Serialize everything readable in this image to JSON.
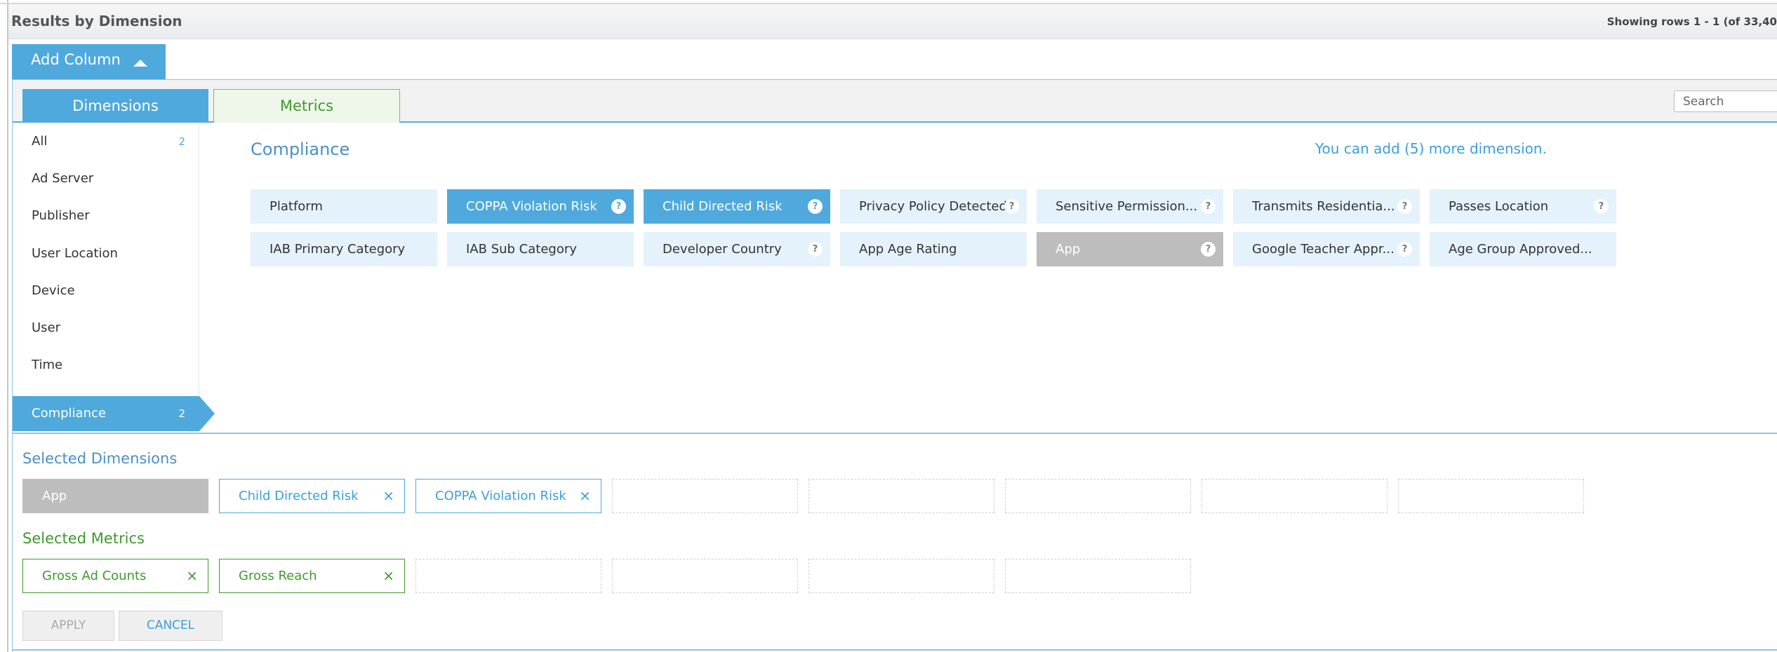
{
  "header": {
    "title": "Results by Dimension",
    "rows": "Showing rows 1 - 1 (of 33,40"
  },
  "add_column": {
    "label": "Add Column"
  },
  "tabs": {
    "dimensions": "Dimensions",
    "metrics": "Metrics"
  },
  "search": {
    "placeholder": "Search"
  },
  "sidebar": {
    "items": [
      {
        "label": "All",
        "count": "2"
      },
      {
        "label": "Ad Server",
        "count": ""
      },
      {
        "label": "Publisher",
        "count": ""
      },
      {
        "label": "User Location",
        "count": ""
      },
      {
        "label": "Device",
        "count": ""
      },
      {
        "label": "User",
        "count": ""
      },
      {
        "label": "Time",
        "count": ""
      },
      {
        "label": "Compliance",
        "count": "2",
        "active": true
      }
    ]
  },
  "main": {
    "title": "Compliance",
    "limit_message": "You can add (5) more dimension.",
    "dimensions": [
      {
        "label": "Platform",
        "state": "available",
        "help": false
      },
      {
        "label": "COPPA Violation Risk",
        "state": "selected",
        "help": true
      },
      {
        "label": "Child Directed Risk",
        "state": "selected",
        "help": true
      },
      {
        "label": "Privacy Policy Detected",
        "state": "available",
        "help": true
      },
      {
        "label": "Sensitive Permission...",
        "state": "available",
        "help": true
      },
      {
        "label": "Transmits Residentia...",
        "state": "available",
        "help": true
      },
      {
        "label": "Passes Location",
        "state": "available",
        "help": true
      },
      {
        "label": "IAB Primary Category",
        "state": "available",
        "help": false
      },
      {
        "label": "IAB Sub Category",
        "state": "available",
        "help": false
      },
      {
        "label": "Developer Country",
        "state": "available",
        "help": true
      },
      {
        "label": "App Age Rating",
        "state": "available",
        "help": false
      },
      {
        "label": "App",
        "state": "fixed",
        "help": true
      },
      {
        "label": "Google Teacher Appr...",
        "state": "available",
        "help": true
      },
      {
        "label": "Age Group Approved...",
        "state": "available",
        "help": false
      }
    ]
  },
  "selected_dimensions": {
    "title": "Selected Dimensions",
    "items": [
      {
        "label": "App",
        "removable": false
      },
      {
        "label": "Child Directed Risk",
        "removable": true
      },
      {
        "label": "COPPA Violation Risk",
        "removable": true
      }
    ]
  },
  "selected_metrics": {
    "title": "Selected Metrics",
    "items": [
      {
        "label": "Gross Ad Counts",
        "removable": true
      },
      {
        "label": "Gross Reach",
        "removable": true
      }
    ]
  },
  "buttons": {
    "apply": "APPLY",
    "cancel": "CANCEL"
  },
  "glyphs": {
    "help": "?",
    "remove": "×"
  },
  "colors": {
    "accent": "#4fa9dc",
    "metric_green": "#3f9a2d",
    "fixed_gray": "#bdbdbd",
    "chip_bg": "#e3f2fb"
  }
}
